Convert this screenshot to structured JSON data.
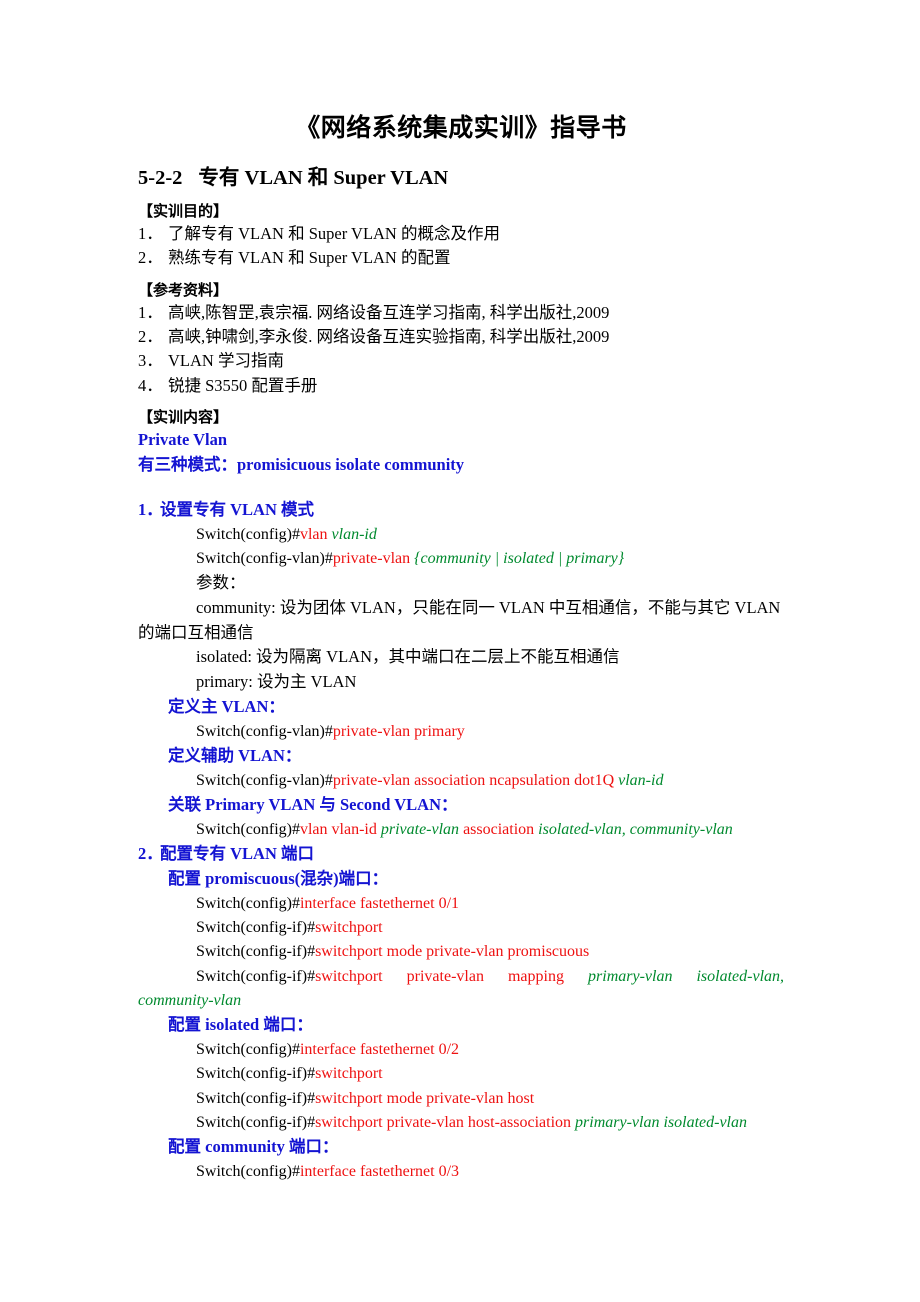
{
  "document": {
    "title": "《网络系统集成实训》指导书",
    "section_number": "5-2-2",
    "section_title": "专有 VLAN 和 Super VLAN"
  },
  "objectives": {
    "heading": "【实训目的】",
    "items": [
      {
        "num": "1．",
        "text": "了解专有 VLAN 和 Super VLAN 的概念及作用"
      },
      {
        "num": "2．",
        "text": "熟练专有 VLAN 和 Super VLAN 的配置"
      }
    ]
  },
  "references": {
    "heading": "【参考资料】",
    "items": [
      {
        "num": "1．",
        "text": "高峡,陈智罡,袁宗福. 网络设备互连学习指南, 科学出版社,2009"
      },
      {
        "num": "2．",
        "text": "高峡,钟啸剑,李永俊. 网络设备互连实验指南, 科学出版社,2009"
      },
      {
        "num": "3．",
        "text": "VLAN 学习指南"
      },
      {
        "num": "4．",
        "text": "锐捷 S3550 配置手册"
      }
    ]
  },
  "content": {
    "heading": "【实训内容】",
    "private_vlan_label": "Private Vlan",
    "modes_line": "有三种模式：promisicuous   isolate community",
    "step1": {
      "num": "1．",
      "title": "设置专有 VLAN 模式",
      "cmd1": {
        "prompt": "Switch(config)#",
        "command": "vlan ",
        "param": "vlan-id"
      },
      "cmd2": {
        "prompt": "Switch(config-vlan)#",
        "command": "private-vlan ",
        "param": "{community | isolated | primary}"
      },
      "params_label": "参数：",
      "param_community": "community: 设为团体 VLAN，只能在同一 VLAN 中互相通信，不能与其它 VLAN 的端口互相通信",
      "param_isolated": "isolated: 设为隔离 VLAN，其中端口在二层上不能互相通信",
      "param_primary": "primary: 设为主 VLAN",
      "define_primary_label": "定义主 VLAN：",
      "define_primary_cmd": {
        "prompt": "Switch(config-vlan)#",
        "command": "private-vlan primary"
      },
      "define_secondary_label": "定义辅助 VLAN：",
      "define_secondary_cmd": {
        "prompt": "Switch(config-vlan)#",
        "command": "private-vlan association ncapsulation dot1Q ",
        "param": "vlan-id"
      },
      "associate_label": "关联 Primary VLAN 与 Second VLAN：",
      "associate_cmd": {
        "prompt": "Switch(config)#",
        "red1": "vlan vlan-id ",
        "green1": "private-vlan ",
        "red2": "association ",
        "green2": "isolated-vlan, community-vlan"
      }
    },
    "step2": {
      "num": "2．",
      "title": "配置专有 VLAN 端口",
      "promiscuous_label": "配置 promiscuous(混杂)端口：",
      "promiscuous_cmds": [
        {
          "prompt": "Switch(config)#",
          "command": "interface fastethernet 0/1"
        },
        {
          "prompt": "Switch(config-if)#",
          "command": "switchport"
        },
        {
          "prompt": "Switch(config-if)#",
          "command": "switchport mode private-vlan promiscuous"
        }
      ],
      "promiscuous_mapping": {
        "prompt": "Switch(config-if)#",
        "red_parts": [
          "switchport",
          "private-vlan",
          "mapping"
        ],
        "green_parts": [
          "primary-vlan",
          "isolated-vlan,"
        ],
        "wrap": "community-vlan"
      },
      "isolated_label": "配置 isolated 端口：",
      "isolated_cmds": [
        {
          "prompt": "Switch(config)#",
          "command": "interface fastethernet 0/2"
        },
        {
          "prompt": "Switch(config-if)#",
          "command": "switchport"
        },
        {
          "prompt": "Switch(config-if)#",
          "command": "switchport mode private-vlan host"
        }
      ],
      "isolated_assoc": {
        "prompt": "Switch(config-if)#",
        "command": "switchport private-vlan host-association ",
        "param": "primary-vlan isolated-vlan"
      },
      "community_label": "配置 community 端口：",
      "community_cmds": [
        {
          "prompt": "Switch(config)#",
          "command": "interface fastethernet 0/3"
        }
      ]
    }
  },
  "colors": {
    "heading_blue": "#1414D2",
    "command_red": "#EE1111",
    "param_green": "#008A2E",
    "text_black": "#000000",
    "page_bg": "#FFFFFF"
  }
}
